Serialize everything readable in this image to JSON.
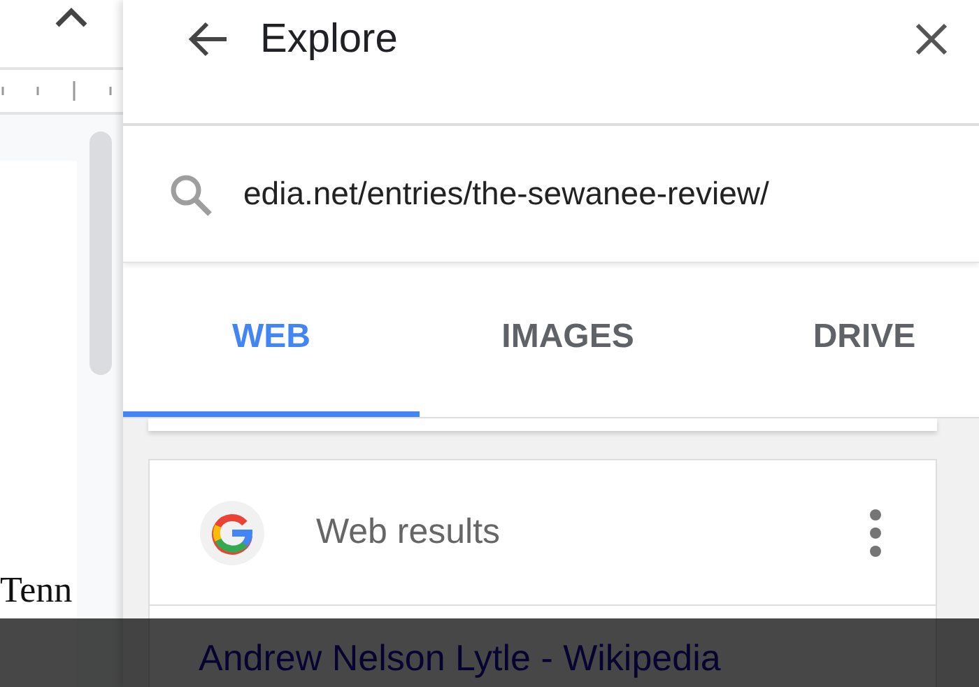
{
  "document": {
    "text": "Tenn"
  },
  "explore": {
    "title": "Explore",
    "search": {
      "value": "edia.net/entries/the-sewanee-review/"
    },
    "tabs": [
      {
        "label": "WEB",
        "selected": true
      },
      {
        "label": "IMAGES",
        "selected": false
      },
      {
        "label": "DRIVE",
        "selected": false
      }
    ],
    "results": {
      "heading": "Web results",
      "items": [
        {
          "title": "Andrew Nelson Lytle - Wikipedia"
        }
      ]
    }
  }
}
